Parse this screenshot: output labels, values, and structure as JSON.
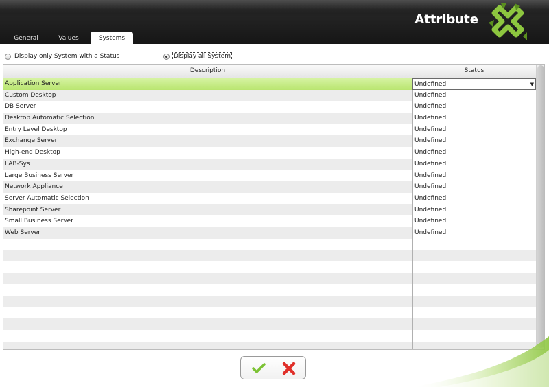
{
  "header": {
    "title": "Attribute"
  },
  "tabs": [
    {
      "label": "General"
    },
    {
      "label": "Values"
    },
    {
      "label": "Systems"
    }
  ],
  "filter": {
    "option_status": "Display only System with a Status",
    "option_all": "Display all System",
    "selected": "option_all"
  },
  "grid": {
    "columns": {
      "description": "Description",
      "status": "Status"
    },
    "rows": [
      {
        "description": "Application Server",
        "status": "Undefined"
      },
      {
        "description": "Custom Desktop",
        "status": "Undefined"
      },
      {
        "description": "DB Server",
        "status": "Undefined"
      },
      {
        "description": "Desktop Automatic Selection",
        "status": "Undefined"
      },
      {
        "description": "Entry Level Desktop",
        "status": "Undefined"
      },
      {
        "description": "Exchange Server",
        "status": "Undefined"
      },
      {
        "description": "High-end Desktop",
        "status": "Undefined"
      },
      {
        "description": "LAB-Sys",
        "status": "Undefined"
      },
      {
        "description": "Large Business Server",
        "status": "Undefined"
      },
      {
        "description": "Network Appliance",
        "status": "Undefined"
      },
      {
        "description": "Server Automatic Selection",
        "status": "Undefined"
      },
      {
        "description": "Sharepoint Server",
        "status": "Undefined"
      },
      {
        "description": "Small Business Server",
        "status": "Undefined"
      },
      {
        "description": "Web Server",
        "status": "Undefined"
      }
    ],
    "selected_row": 0,
    "empty_rows": 10
  },
  "colors": {
    "accent_green": "#8dc63f",
    "selection": "#c6ec86",
    "header_dark": "#1e1e1e"
  },
  "icons": {
    "ok": "checkmark-icon",
    "cancel": "cross-icon",
    "logo": "brand-logo-icon"
  }
}
